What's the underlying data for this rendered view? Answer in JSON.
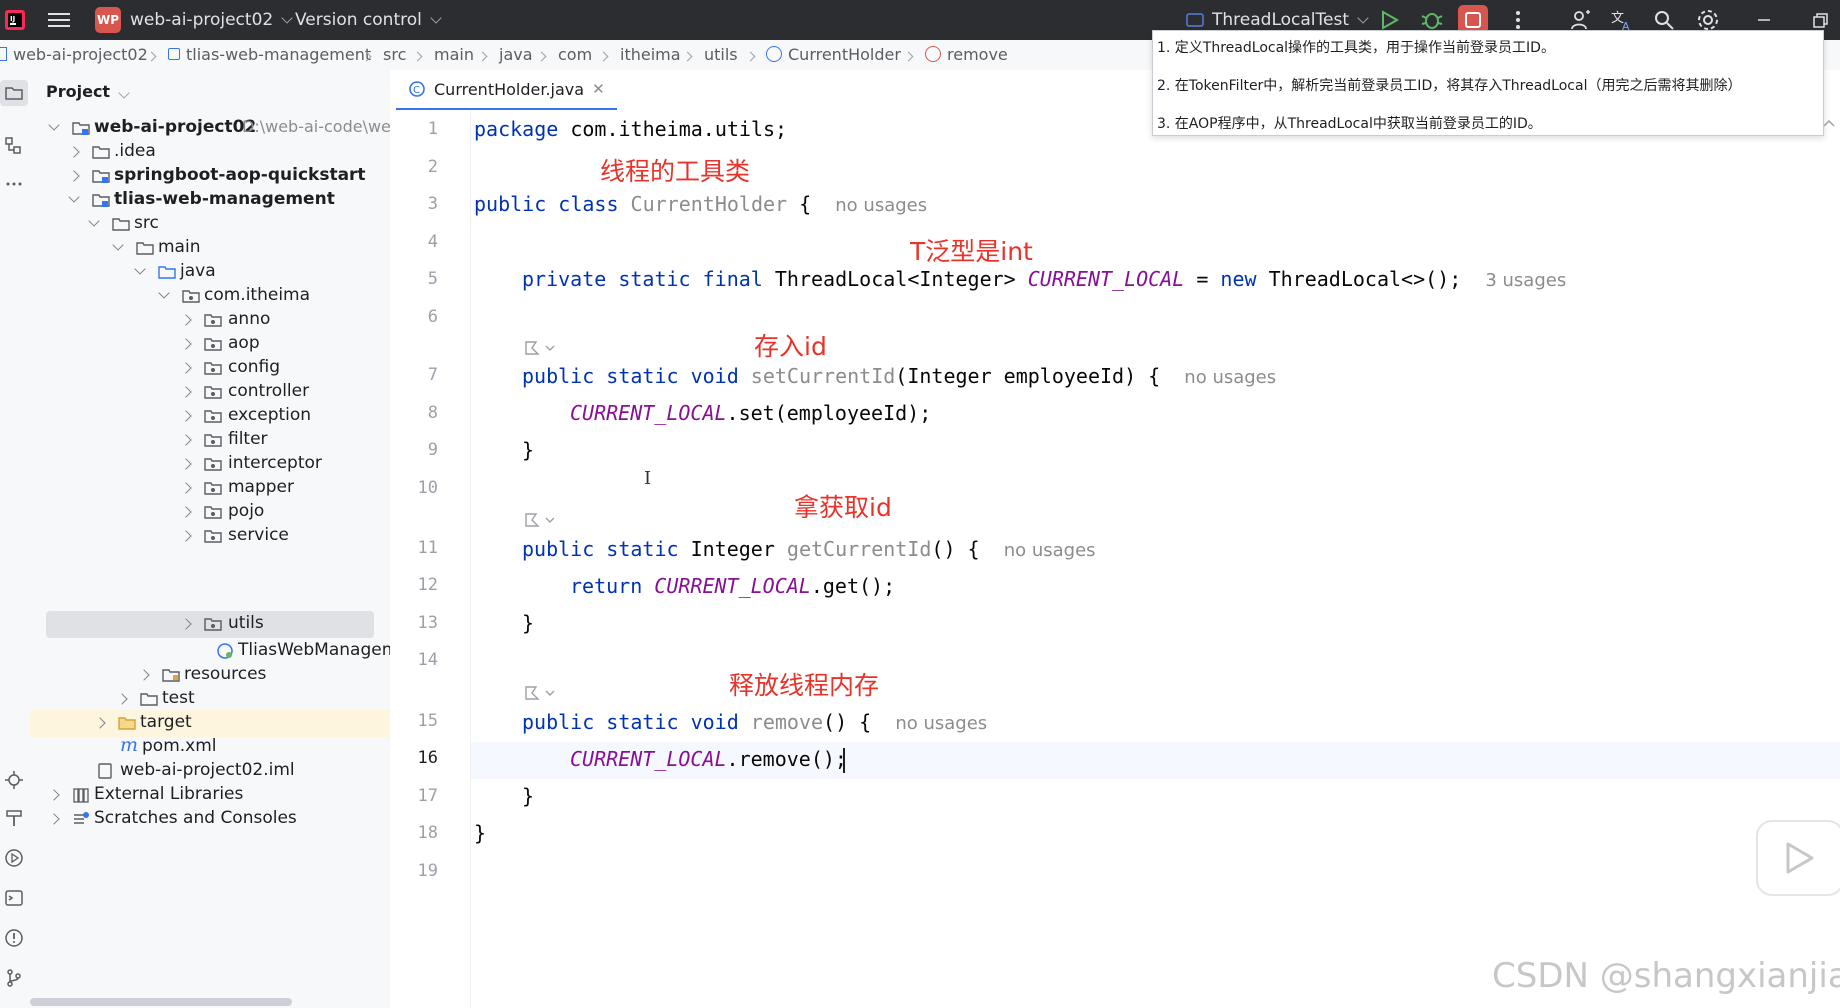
{
  "titlebar": {
    "project_badge": "WP",
    "project_name": "web-ai-project02",
    "vcs": "Version control",
    "run_config": "ThreadLocalTest"
  },
  "breadcrumb": [
    "web-ai-project02",
    "tlias-web-management",
    "src",
    "main",
    "java",
    "com",
    "itheima",
    "utils",
    "CurrentHolder",
    "remove"
  ],
  "project_panel": {
    "title": "Project",
    "tree": [
      {
        "label": "web-ai-project02",
        "path": "D:\\web-ai-code\\we"
      },
      {
        "label": ".idea"
      },
      {
        "label": "springboot-aop-quickstart"
      },
      {
        "label": "tlias-web-management"
      },
      {
        "label": "src"
      },
      {
        "label": "main"
      },
      {
        "label": "java"
      },
      {
        "label": "com.itheima"
      },
      {
        "label": "anno"
      },
      {
        "label": "aop"
      },
      {
        "label": "config"
      },
      {
        "label": "controller"
      },
      {
        "label": "exception"
      },
      {
        "label": "filter"
      },
      {
        "label": "interceptor"
      },
      {
        "label": "mapper"
      },
      {
        "label": "pojo"
      },
      {
        "label": "service"
      },
      {
        "label": "utils"
      },
      {
        "label": "TliasWebManageme"
      },
      {
        "label": "resources"
      },
      {
        "label": "test"
      },
      {
        "label": "target"
      },
      {
        "label": "pom.xml"
      },
      {
        "label": "web-ai-project02.iml"
      },
      {
        "label": "External Libraries"
      },
      {
        "label": "Scratches and Consoles"
      }
    ]
  },
  "tab": {
    "label": "CurrentHolder.java"
  },
  "line_numbers": [
    "1",
    "2",
    "3",
    "4",
    "5",
    "6",
    "7",
    "8",
    "9",
    "10",
    "11",
    "12",
    "13",
    "14",
    "15",
    "16",
    "17",
    "18",
    "19"
  ],
  "code": {
    "l1_kw": "package",
    "l1_rest": " com.itheima.utils;",
    "l3_kw": "public class",
    "l3_name": " CurrentHolder",
    "l3_rest": " {",
    "l3_hint": "no usages",
    "l5_kw": "private static final",
    "l5_type": " ThreadLocal<Integer> ",
    "l5_field": "CURRENT_LOCAL",
    "l5_eq": " = ",
    "l5_new": "new",
    "l5_rest": " ThreadLocal<>();",
    "l5_hint": "3 usages",
    "l7_kw": "public static void",
    "l7_name": " setCurrentId",
    "l7_rest": "(Integer employeeId) {",
    "l7_hint": "no usages",
    "l8_field": "CURRENT_LOCAL",
    "l8_rest": ".set(employeeId);",
    "brace": "}",
    "l11_kw": "public static",
    "l11_type": " Integer ",
    "l11_name": "getCurrentId",
    "l11_rest": "() {",
    "l11_hint": "no usages",
    "l12_kw": "return",
    "l12_sp": " ",
    "l12_field": "CURRENT_LOCAL",
    "l12_rest": ".get();",
    "l15_kw": "public static void",
    "l15_name": " remove",
    "l15_rest": "() {",
    "l15_hint": "no usages",
    "l16_field": "CURRENT_LOCAL",
    "l16_rest": ".remove();"
  },
  "annotations": {
    "a1": "线程的工具类",
    "a2": "T泛型是int",
    "a3": "存入id",
    "a4": "拿获取id",
    "a5": "释放线程内存"
  },
  "popup": {
    "l1": "1. 定义ThreadLocal操作的工具类，用于操作当前登录员工ID。",
    "l2": "2. 在TokenFilter中，解析完当前登录员工ID，将其存入ThreadLocal（用完之后需将其删除）",
    "l3": "3. 在AOP程序中，从ThreadLocal中获取当前登录员工的ID。"
  },
  "watermark": "CSDN @shangxianjiao",
  "colors": {
    "keyword": "#0033b3",
    "field": "#871094",
    "annotation": "#e8332a",
    "accent": "#3574f0"
  }
}
